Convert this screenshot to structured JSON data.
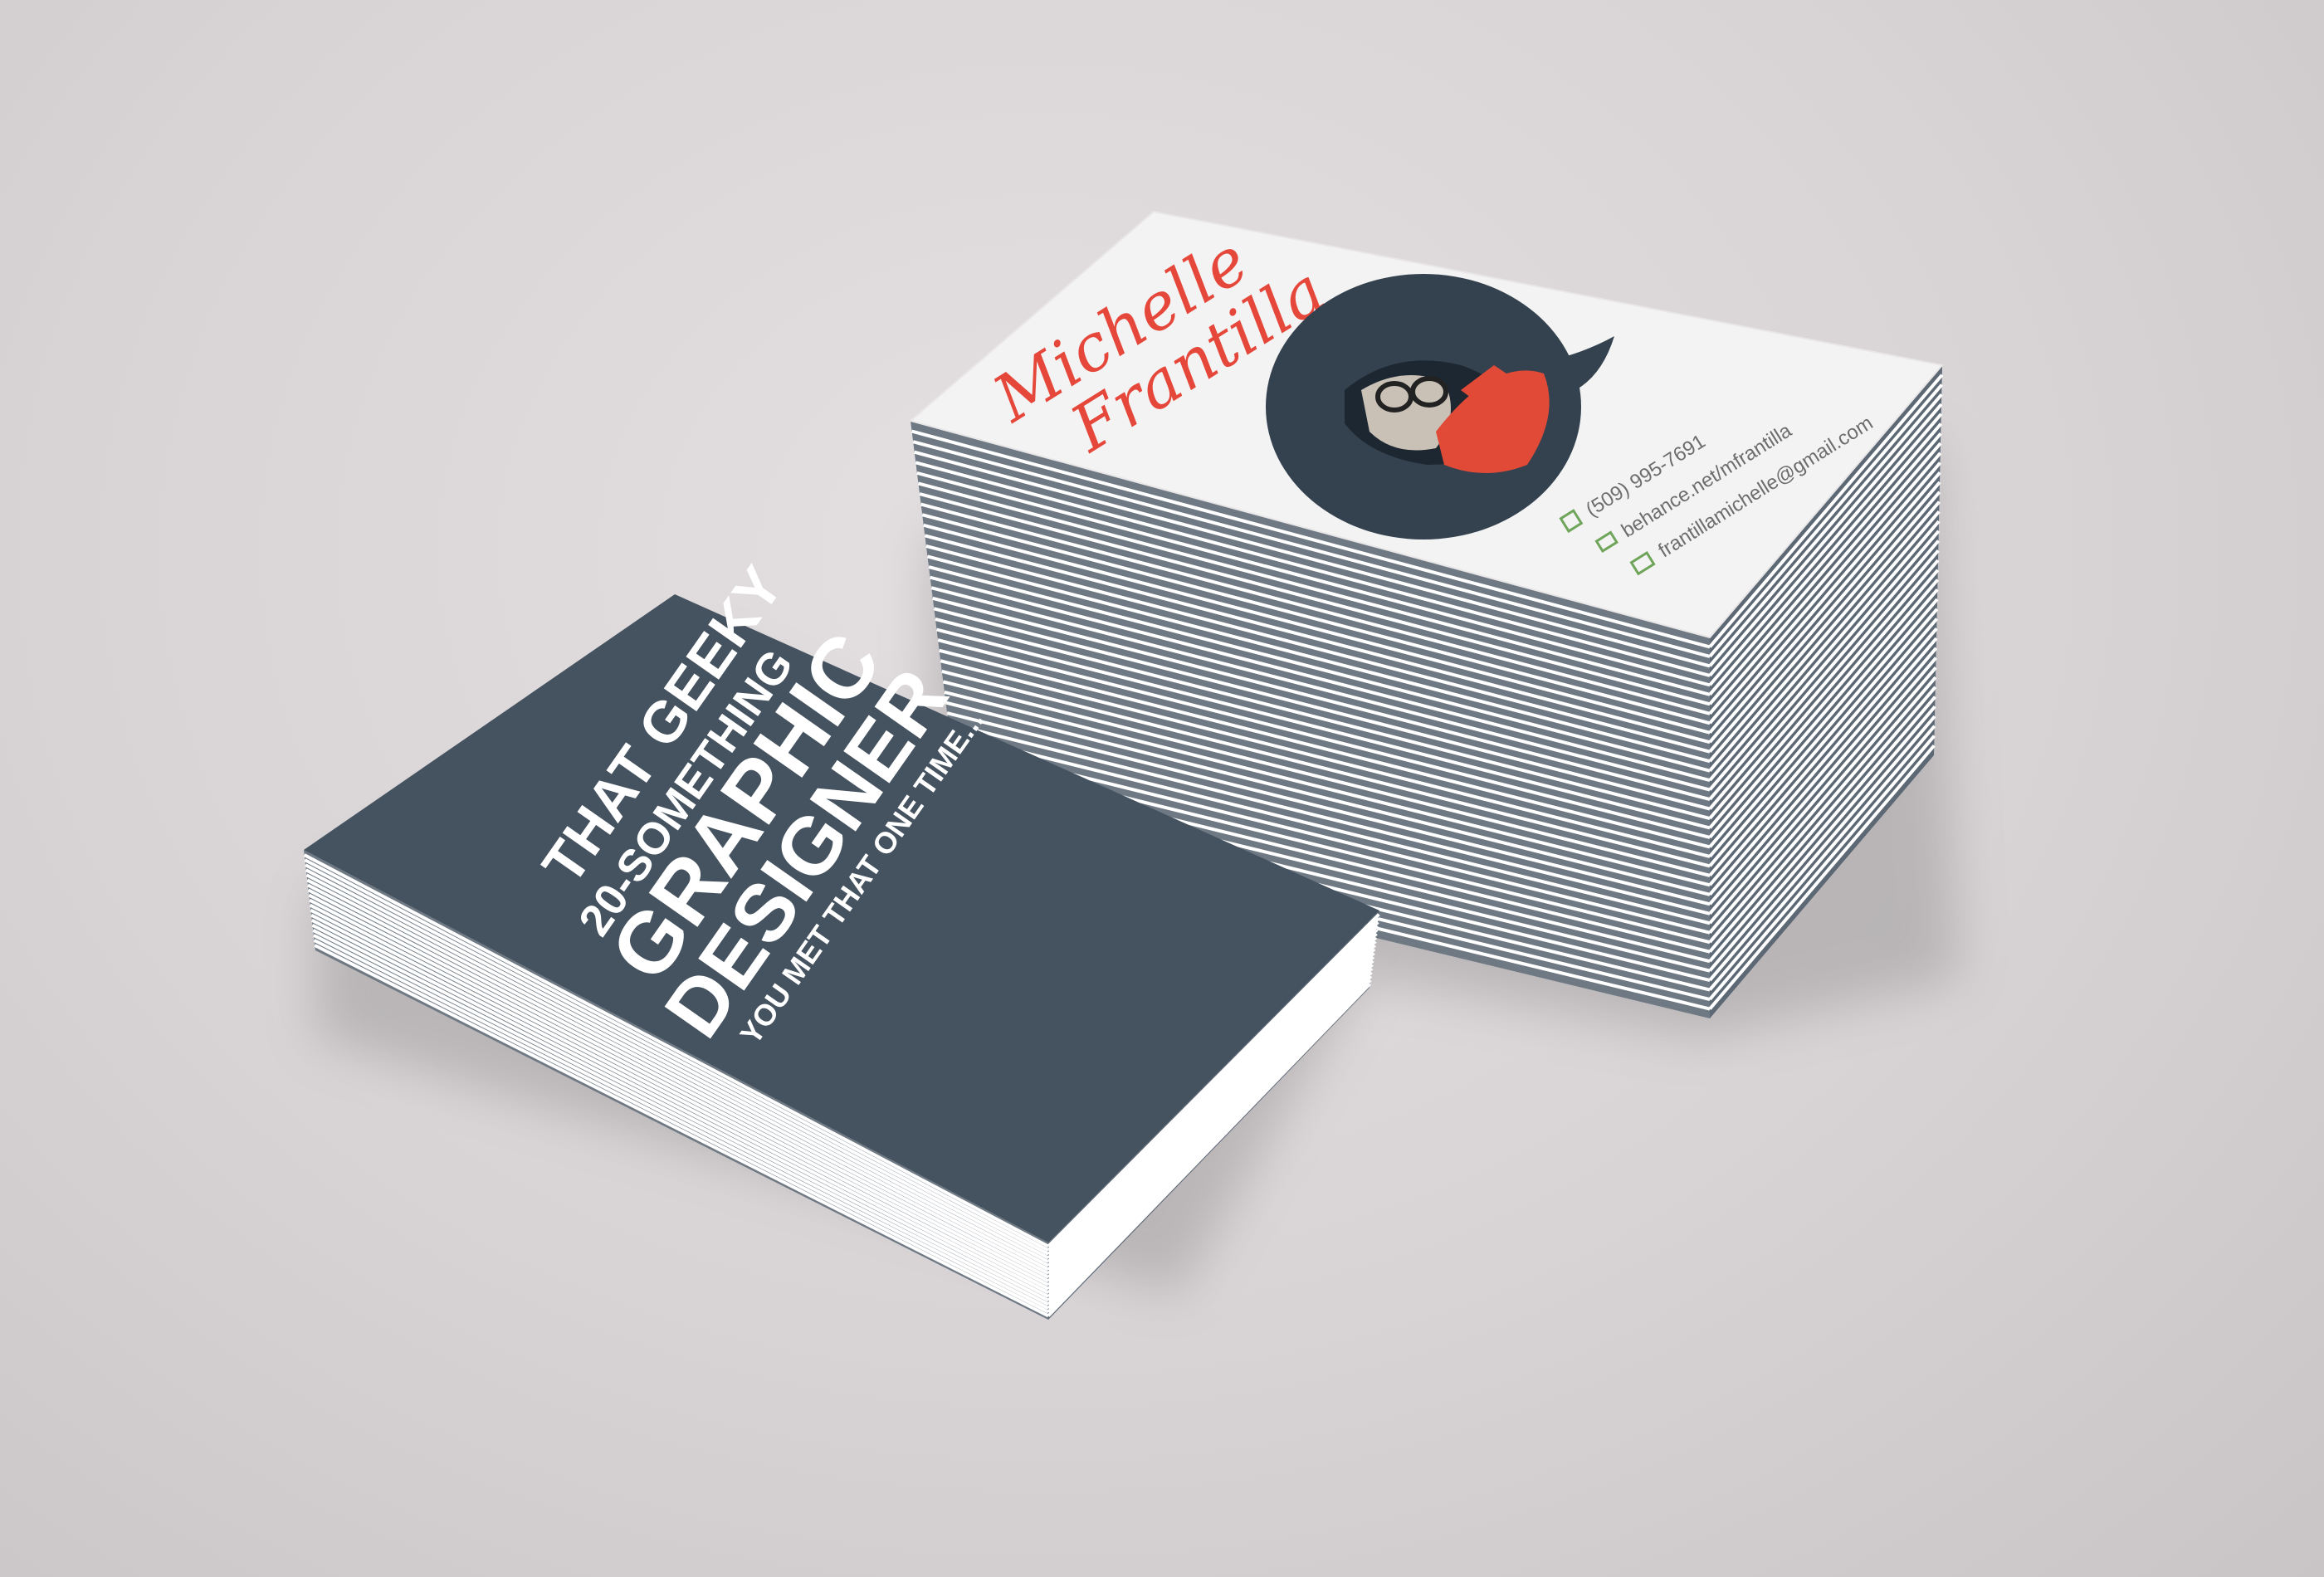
{
  "scene": {
    "background_color": "#d9d5d7",
    "card_edge_color": "#ffffff",
    "stack_line_color": "#6d7884"
  },
  "back_card": {
    "color": "#45525f",
    "text_color": "#ffffff",
    "line1": "THAT GEEKY",
    "line2": "20-SOMETHING",
    "line3": "GRAPHIC",
    "line4": "DESIGNER",
    "line5": "YOU MET THAT ONE TIME..."
  },
  "front_card": {
    "color": "#f4f3f3",
    "name_first": "Michelle",
    "name_last": "Frantilla",
    "name_color": "#e5473a",
    "avatar_bg": "#34424f",
    "avatar_accent": "#e04a37",
    "contact_icon_color": "#6ea55a",
    "contact_text_color": "#6d6d6d",
    "contacts": [
      {
        "icon": "phone-icon",
        "text": "(509) 995-7691"
      },
      {
        "icon": "monitor-icon",
        "text": "behance.net/mfrantilla"
      },
      {
        "icon": "mail-icon",
        "text": "frantillamichelle@gmail.com"
      }
    ]
  }
}
